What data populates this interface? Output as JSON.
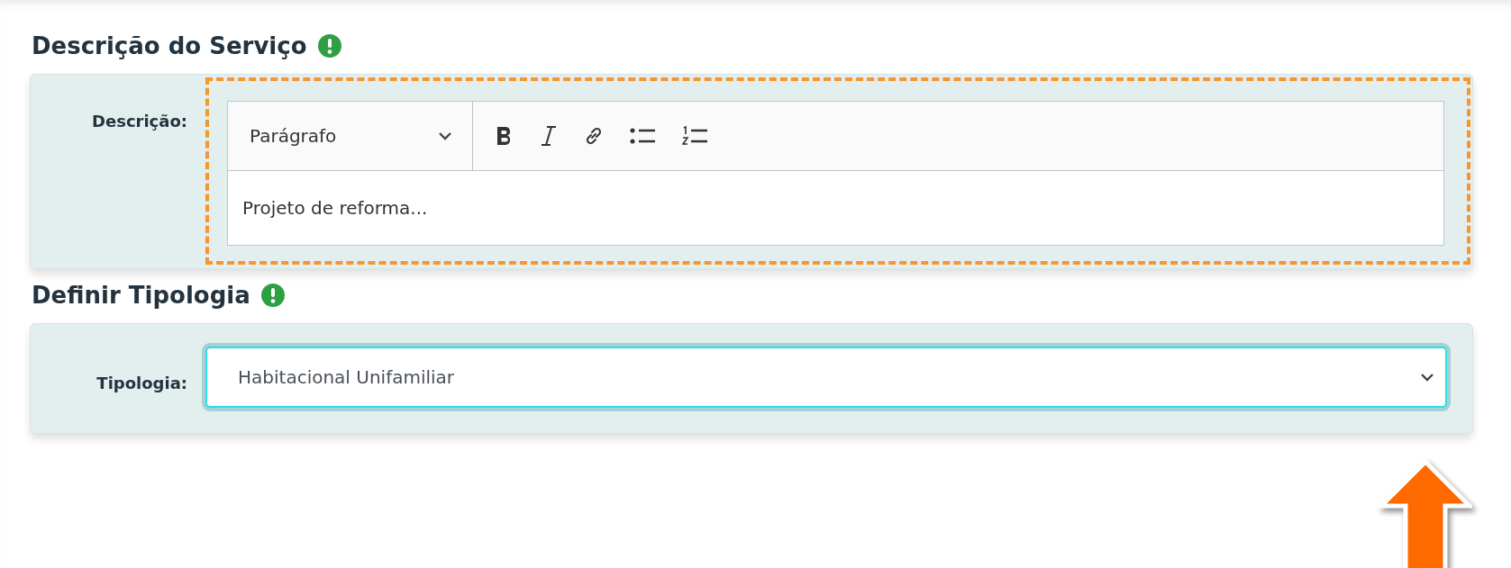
{
  "sections": [
    {
      "kind": "editor",
      "title": "Descrição do Serviço",
      "required": true,
      "label": "Descrição:",
      "format": "Parágrafo",
      "value": "Projeto de reforma...",
      "highlighted": true
    },
    {
      "kind": "select",
      "title": "Definir Tipologia",
      "required": true,
      "label": "Tipologia:",
      "value": "Habitacional Unifamiliar",
      "focused": true
    }
  ]
}
